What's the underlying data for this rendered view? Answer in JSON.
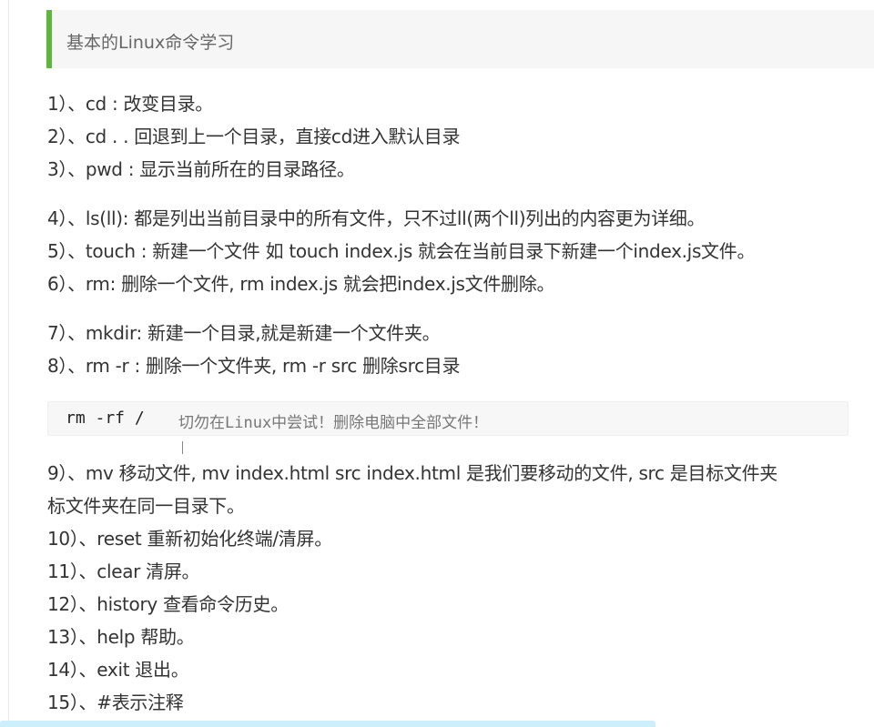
{
  "heading": "基本的Linux命令学习",
  "items": [
    "1）、cd : 改变目录。",
    "2）、cd . . 回退到上一个目录，直接cd进入默认目录",
    "3）、pwd : 显示当前所在的目录路径。",
    "4）、ls(ll):  都是列出当前目录中的所有文件，只不过ll(两个ll)列出的内容更为详细。",
    "5）、touch : 新建一个文件 如 touch index.js 就会在当前目录下新建一个index.js文件。",
    "6）、rm:  删除一个文件, rm index.js 就会把index.js文件删除。",
    "7）、mkdir:  新建一个目录,就是新建一个文件夹。",
    "8）、rm -r :  删除一个文件夹, rm -r src 删除src目录",
    "9）、mv 移动文件, mv index.html src index.html 是我们要移动的文件, src 是目标文件夹",
    "标文件夹在同一目录下。",
    "10）、reset 重新初始化终端/清屏。",
    "11）、clear 清屏。",
    "12）、history 查看命令历史。",
    "13）、help 帮助。",
    "14）、exit 退出。",
    "15）、#表示注释"
  ],
  "code": {
    "command": "rm -rf /",
    "comment": "切勿在Linux中尝试！删除电脑中全部文件！"
  }
}
